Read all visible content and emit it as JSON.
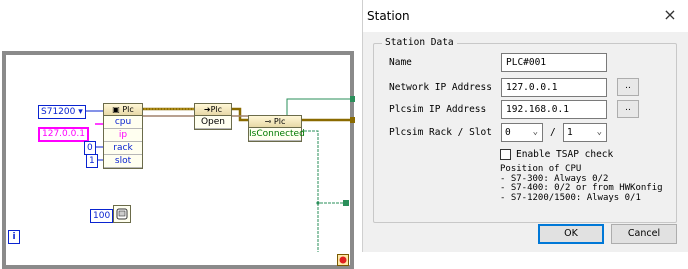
{
  "block_diagram": {
    "controls": {
      "type_const": "S71200",
      "ip_const": "127.0.0.1",
      "rack_const": "0",
      "slot_const": "1",
      "wait_const": "100"
    },
    "create_node": {
      "title": "Plc",
      "rows": [
        "cpu",
        "ip",
        "rack",
        "slot"
      ]
    },
    "open_node": {
      "title": "Plc",
      "rows": [
        "Open"
      ]
    },
    "connected_node": {
      "title": "Plc",
      "rows": [
        "IsConnected"
      ]
    },
    "info_label": "i"
  },
  "dialog": {
    "title": "Station",
    "close_glyph": "×",
    "group_label": "Station Data",
    "fields": {
      "name_label": "Name",
      "name_value": "PLC#001",
      "network_ip_label": "Network IP Address",
      "network_ip_value": "127.0.0.1",
      "plcsim_ip_label": "Plcsim IP Address",
      "plcsim_ip_value": "192.168.0.1",
      "rack_slot_label": "Plcsim Rack / Slot",
      "rack_value": "0",
      "slot_separator": "/",
      "slot_value": "1",
      "browse_label": ".."
    },
    "tsap_label": "Enable TSAP check",
    "cpu_note": "Position of CPU\n- S7-300: Always 0/2\n- S7-400: 0/2 or from HWKonfig\n- S7-1200/1500: Always 0/1",
    "ok_label": "OK",
    "cancel_label": "Cancel"
  }
}
